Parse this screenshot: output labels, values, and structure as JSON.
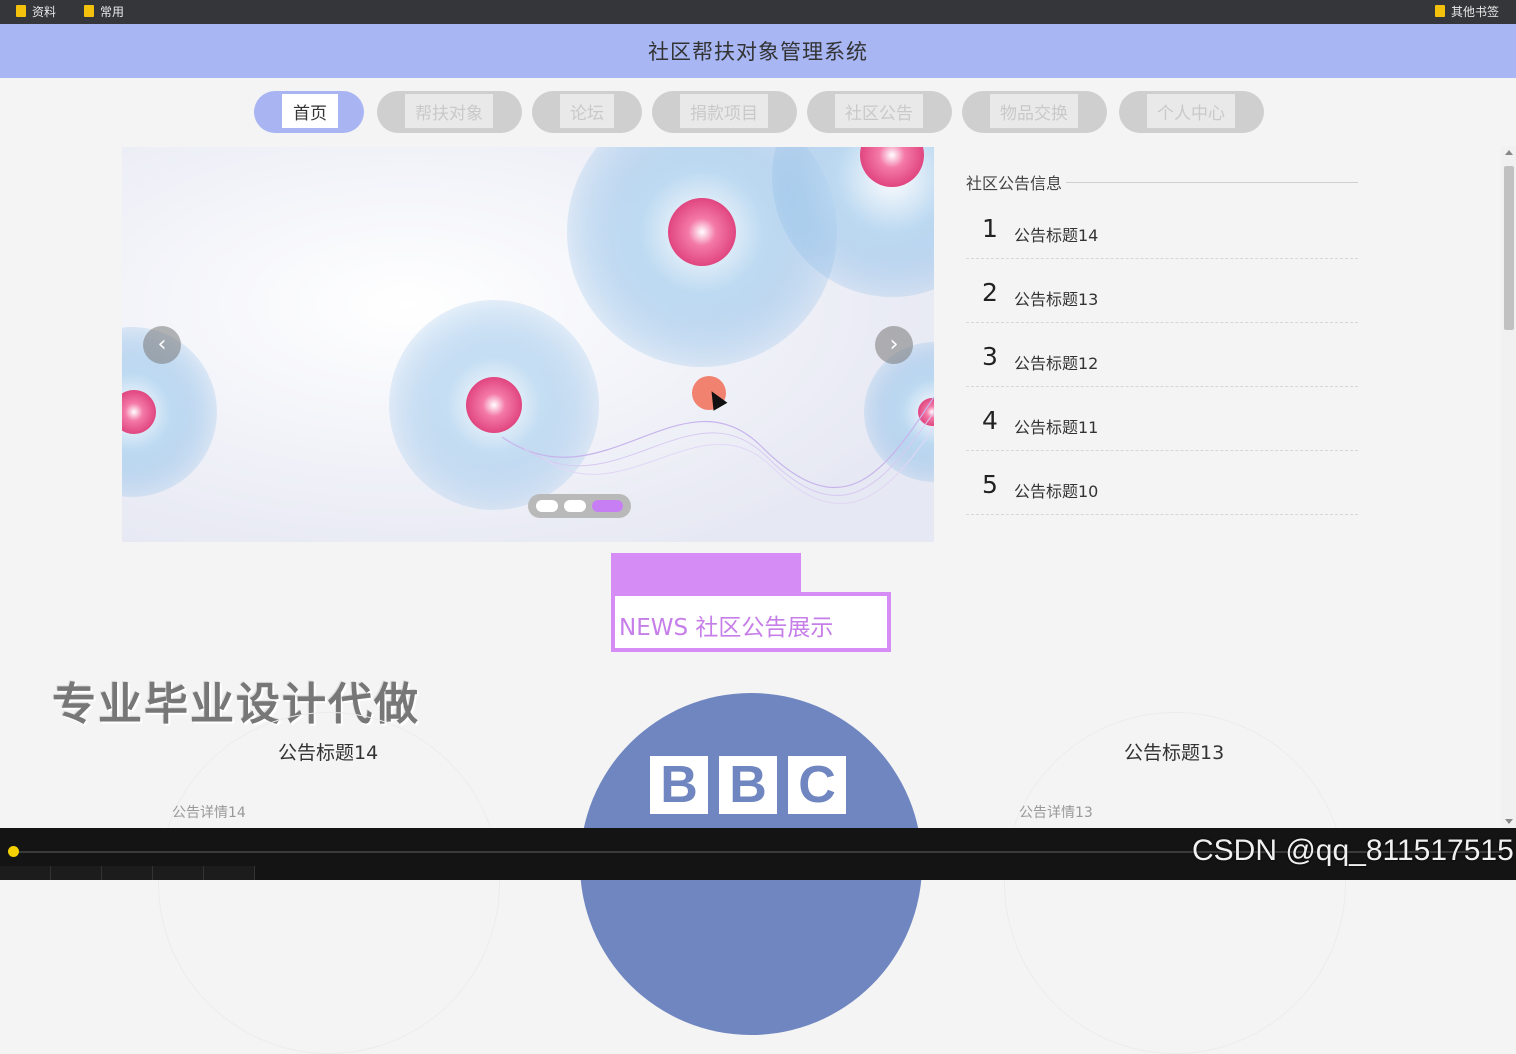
{
  "bookmarks": {
    "items": [
      {
        "label": "资料"
      },
      {
        "label": "常用"
      }
    ],
    "other": "其他书签"
  },
  "header": {
    "title": "社区帮扶对象管理系统"
  },
  "nav": {
    "items": [
      {
        "label": "首页",
        "active": true
      },
      {
        "label": "帮扶对象",
        "active": false
      },
      {
        "label": "论坛",
        "active": false
      },
      {
        "label": "捐款项目",
        "active": false
      },
      {
        "label": "社区公告",
        "active": false
      },
      {
        "label": "物品交换",
        "active": false
      },
      {
        "label": "个人中心",
        "active": false
      }
    ]
  },
  "carousel": {
    "prev_icon": "chevron-left-icon",
    "next_icon": "chevron-right-icon",
    "slide_count": 3,
    "active_index": 2
  },
  "notices": {
    "title": "社区公告信息",
    "items": [
      {
        "num": "1",
        "title": "公告标题14"
      },
      {
        "num": "2",
        "title": "公告标题13"
      },
      {
        "num": "3",
        "title": "公告标题12"
      },
      {
        "num": "4",
        "title": "公告标题11"
      },
      {
        "num": "5",
        "title": "公告标题10"
      }
    ]
  },
  "news": {
    "heading": "NEWS 社区公告展示"
  },
  "watermark": "专业毕业设计代做",
  "cards": [
    {
      "title": "公告标题14",
      "detail": "公告详情14"
    },
    {
      "title": "公告标题13",
      "detail": "公告详情13"
    }
  ],
  "bbc": {
    "letters": [
      "B",
      "B",
      "C"
    ]
  },
  "player": {
    "watermark": "CSDN @qq_811517515"
  },
  "colors": {
    "header": "#a8b6f4",
    "accent": "#d58cf5",
    "nav_active": "#a9b5f3",
    "bbc": "#6f86c0"
  }
}
